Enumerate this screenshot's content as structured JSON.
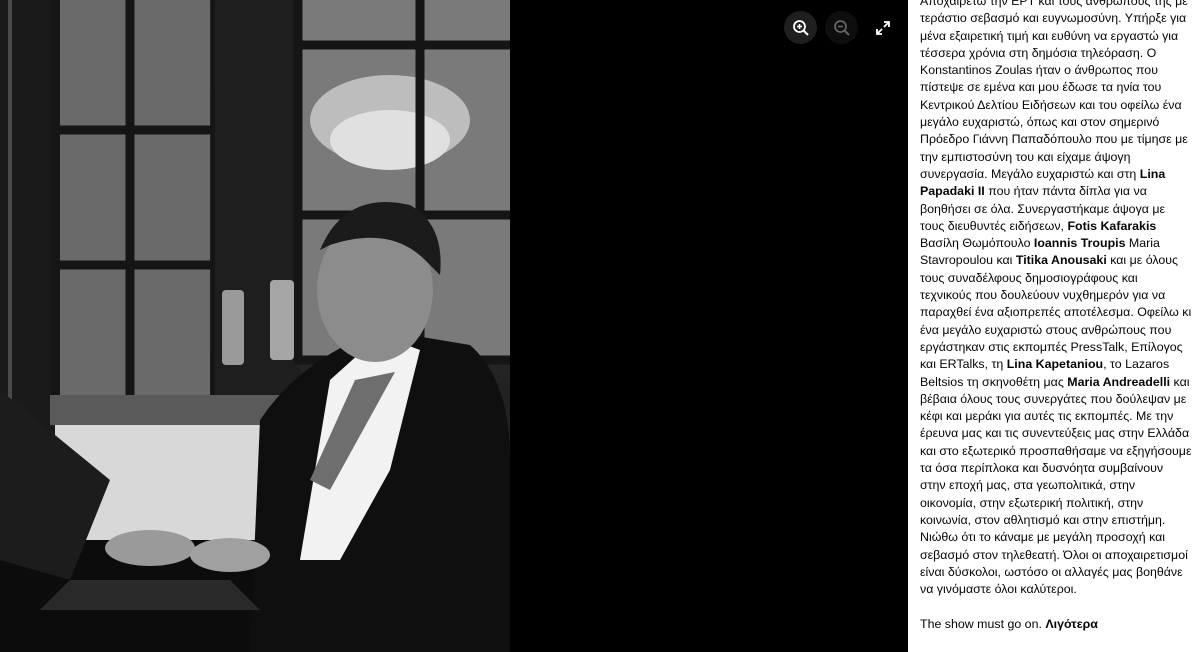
{
  "controls": {
    "zoom_in_icon": "zoom-in-icon",
    "zoom_out_icon": "zoom-out-icon",
    "fullscreen_icon": "fullscreen-icon"
  },
  "colors": {
    "sidebar_bg": "#ffffff",
    "text": "#050505",
    "viewer_bg": "#000000"
  },
  "caption": {
    "t1": "Αποχαιρετώ την ΕΡΤ και τους ανθρώπους της με τεράστιο σεβασμό και ευγνωμοσύνη. Υπήρξε για μένα εξαιρετική τιμή και ευθύνη να εργαστώ για τέσσερα χρόνια στη δημόσια τηλεόραση. Ο Konstantinos Zoulas ήταν ο άνθρωπος που πίστεψε σε εμένα και μου έδωσε τα ηνία του Κεντρικού Δελτίου Ειδήσεων και του οφείλω ένα μεγάλο ευχαριστώ, όπως και στον σημερινό Πρόεδρο Γιάννη Παπαδόπουλο που με τίμησε με την εμπιστοσύνη του και είχαμε άψογη συνεργασία. Μεγάλο ευχαριστώ και στη ",
    "tag1": "Lina Papadaki II",
    "t2": " που ήταν πάντα δίπλα για να βοηθήσει σε όλα. Συνεργαστήκαμε άψογα με τους διευθυντές ειδήσεων, ",
    "tag2": "Fotis Kafarakis",
    "t3": " Βασίλη Θωμόπουλο ",
    "tag3": "Ioannis Troupis",
    "t4": " Maria Stavropoulou και ",
    "tag4": "Titika Anousaki",
    "t5": " και με όλους τους συναδέλφους δημοσιογράφους και τεχνικούς που δουλεύουν νυχθημερόν για να παραχθεί ένα αξιοπρεπές αποτέλεσμα. Οφείλω κι ένα μεγάλο ευχαριστώ στους ανθρώπους που εργάστηκαν στις εκπομπές PressTalk, Επίλογος και ERTalks, τη ",
    "tag5": "Lina Kapetaniou",
    "t6": ", το Lazaros Beltsios τη σκηνοθέτη μας ",
    "tag6": "Maria Andreadelli",
    "t7": " και βέβαια όλους τους συνεργάτες που δούλεψαν με κέφι και μεράκι για αυτές τις εκπομπές. Με την έρευνα μας και τις συνεντεύξεις μας στην Ελλάδα και στο εξωτερικό προσπαθήσαμε να εξηγήσουμε τα όσα περίπλοκα και δυσνόητα συμβαίνουν στην εποχή μας, στα γεωπολιτικά, στην οικονομία, στην εξωτερική πολιτική, στην κοινωνία, στον αθλητισμό και στην επιστήμη. Νιώθω ότι το κάναμε με μεγάλη προσοχή και σεβασμό στον τηλεθεατή. Όλοι οι αποχαιρετισμοί είναι δύσκολοι, ωστόσο οι αλλαγές μας βοηθάνε να γινόμαστε όλοι καλύτεροι.",
    "closing": "The show must go on. ",
    "see_less": "Λιγότερα"
  }
}
